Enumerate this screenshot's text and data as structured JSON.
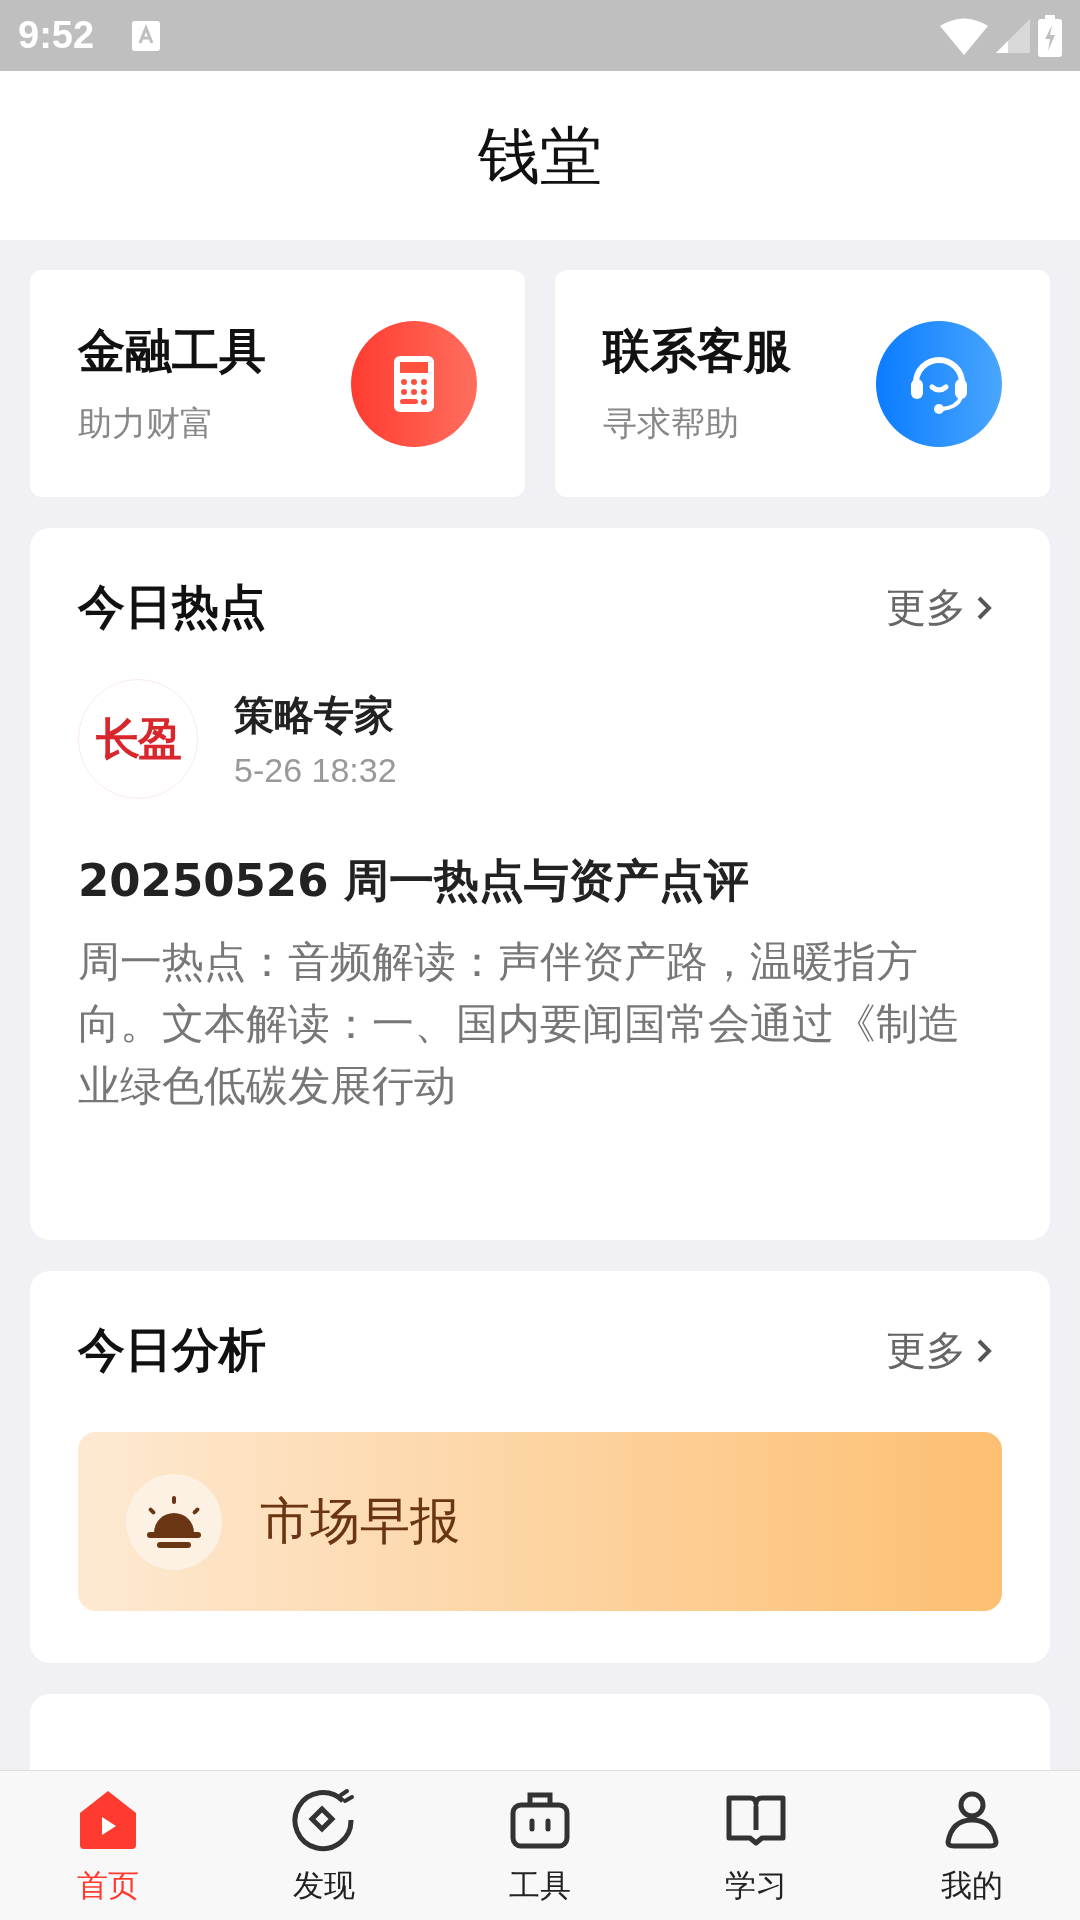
{
  "status_bar": {
    "time": "9:52"
  },
  "header": {
    "title": "钱堂"
  },
  "quick_cards": [
    {
      "title": "金融工具",
      "subtitle": "助力财富",
      "kind": "calculator"
    },
    {
      "title": "联系客服",
      "subtitle": "寻求帮助",
      "kind": "support"
    }
  ],
  "hot_today": {
    "title": "今日热点",
    "more": "更多",
    "author": {
      "logo": "长盈",
      "name": "策略专家",
      "time": "5-26 18:32"
    },
    "headline": "20250526 周一热点与资产点评",
    "summary": "周一热点：音频解读：声伴资产路，温暖指方向。文本解读：一、国内要闻国常会通过《制造业绿色低碳发展行动"
  },
  "analysis_today": {
    "title": "今日分析",
    "more": "更多",
    "banner": "市场早报"
  },
  "tab_bar": [
    {
      "label": "首页",
      "kind": "home",
      "selected": true
    },
    {
      "label": "发现",
      "kind": "discover",
      "selected": false
    },
    {
      "label": "工具",
      "kind": "tools",
      "selected": false
    },
    {
      "label": "学习",
      "kind": "book",
      "selected": false
    },
    {
      "label": "我的",
      "kind": "person",
      "selected": false
    }
  ]
}
